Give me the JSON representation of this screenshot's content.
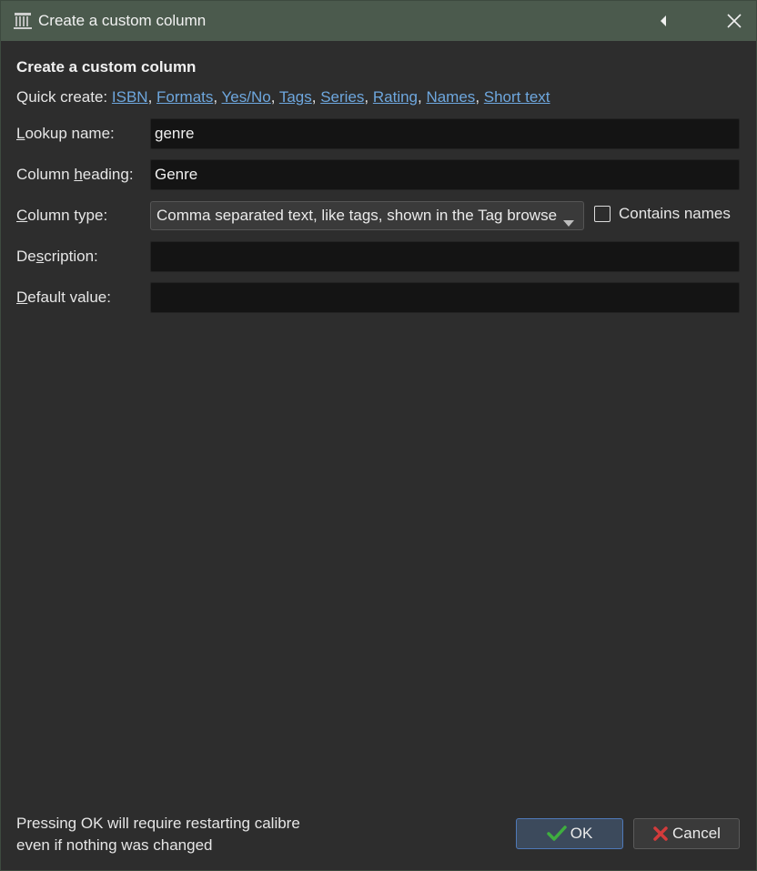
{
  "window": {
    "title": "Create a custom column",
    "icons": {
      "app": "calibre-library-icon",
      "back": "triangle-left-icon",
      "close": "close-icon"
    }
  },
  "dialog": {
    "heading": "Create a custom column",
    "quick_create": {
      "label": "Quick create:",
      "links": [
        "ISBN",
        "Formats",
        "Yes/No",
        "Tags",
        "Series",
        "Rating",
        "Names",
        "Short text"
      ]
    },
    "fields": {
      "lookup_name": {
        "label_pre": "",
        "label_accel": "L",
        "label_post": "ookup name:",
        "value": "genre"
      },
      "column_heading": {
        "label_pre": "Column ",
        "label_accel": "h",
        "label_post": "eading:",
        "value": "Genre"
      },
      "column_type": {
        "label_pre": "",
        "label_accel": "C",
        "label_post": "olumn type:",
        "value": "Comma separated text, like tags, shown in the Tag browser"
      },
      "description": {
        "label_pre": "De",
        "label_accel": "s",
        "label_post": "cription:",
        "value": ""
      },
      "default_value": {
        "label_pre": "",
        "label_accel": "D",
        "label_post": "efault value:",
        "value": ""
      }
    },
    "contains_names": {
      "label": "Contains names",
      "checked": false
    }
  },
  "footer": {
    "note_line1": "Pressing OK will require restarting calibre",
    "note_line2": "even if nothing was changed",
    "ok_label": "OK",
    "cancel_label": "Cancel"
  },
  "colors": {
    "titlebar": "#4b5a4d",
    "background": "#2d2d2d",
    "link": "#6ea7de",
    "ok_check": "#3fae3f",
    "cancel_x": "#d23b3b"
  }
}
